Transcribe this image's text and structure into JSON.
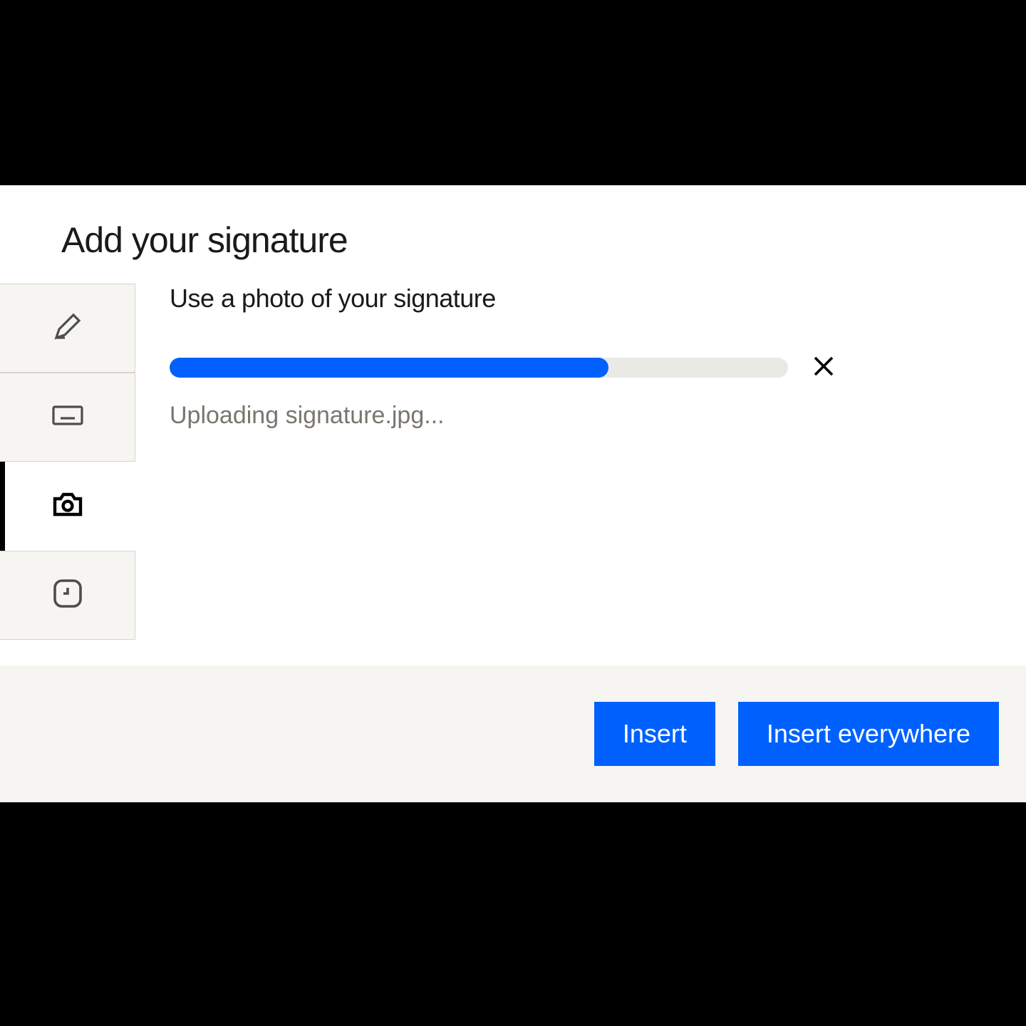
{
  "dialog": {
    "title": "Add your signature",
    "subheading": "Use a photo of your signature",
    "upload": {
      "progress_percent": 71,
      "status_text": "Uploading signature.jpg..."
    }
  },
  "sidebar": {
    "tabs": [
      {
        "name": "draw",
        "icon": "pencil-icon"
      },
      {
        "name": "type",
        "icon": "keyboard-icon"
      },
      {
        "name": "photo",
        "icon": "camera-icon",
        "active": true
      },
      {
        "name": "recent",
        "icon": "clock-icon"
      }
    ]
  },
  "footer": {
    "insert_label": "Insert",
    "insert_everywhere_label": "Insert everywhere"
  },
  "colors": {
    "accent": "#0061fe",
    "muted_bg": "#f7f5f2",
    "track": "#ebe9e6",
    "text_muted": "#7a766f"
  }
}
